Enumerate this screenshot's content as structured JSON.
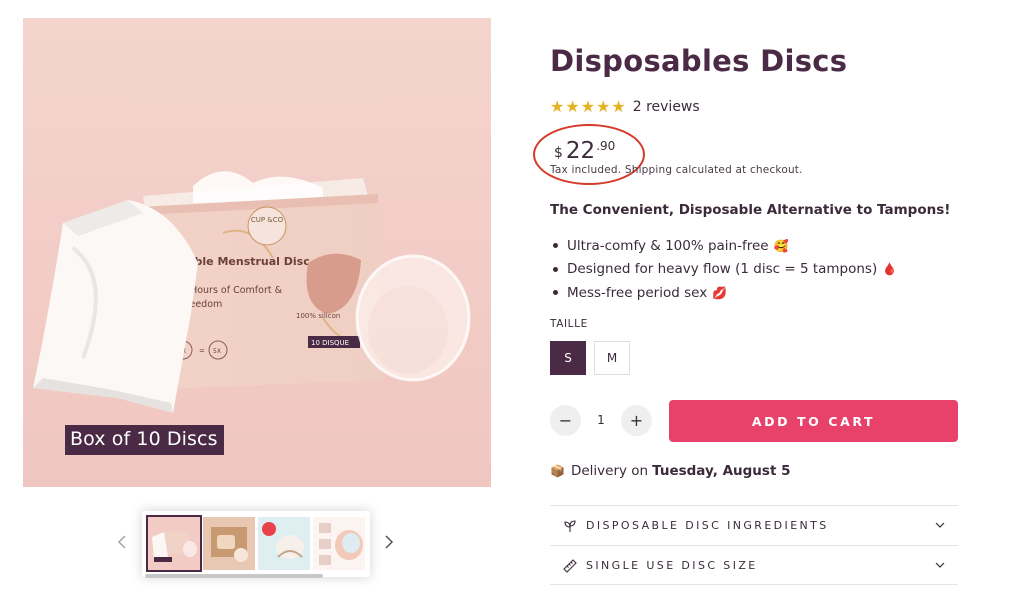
{
  "gallery": {
    "caption": "Box of 10 Discs",
    "product_box_text": {
      "brand": "CUP &CO",
      "name": "osable Menstrual Disc",
      "line1": "2 Hours of Comfort &",
      "line2": "Freedom",
      "silicone": "100% silicon",
      "qty": "10 DISQUE",
      "eq_left": "1X",
      "eq_right": "5X"
    },
    "thumbnail_count": 4,
    "selected_index": 0
  },
  "product": {
    "title": "Disposables Discs",
    "rating": 5,
    "stars": "★★★★★",
    "reviews": "2 reviews",
    "price": {
      "currency": "$",
      "whole": "22",
      "cents": ".90"
    },
    "tax_note": "Tax included. Shipping calculated at checkout.",
    "tagline": "The Convenient, Disposable Alternative to Tampons!",
    "bullets": [
      {
        "text": "Ultra-comfy & 100% pain-free",
        "emoji": "🥰"
      },
      {
        "text": "Designed for heavy flow (1 disc = 5 tampons)",
        "emoji": "🩸"
      },
      {
        "text": "Mess-free period sex",
        "emoji": "💋"
      }
    ]
  },
  "variants": {
    "label": "TAILLE",
    "options": [
      "S",
      "M"
    ],
    "selected": "S"
  },
  "cart": {
    "minus": "−",
    "plus": "+",
    "quantity": "1",
    "add_label": "ADD TO CART"
  },
  "delivery": {
    "icon": "📦",
    "prefix": "Delivery on",
    "date": "Tuesday, August 5"
  },
  "accordion": [
    {
      "label": "DISPOSABLE DISC INGREDIENTS",
      "icon": "leaf-icon"
    },
    {
      "label": "SINGLE USE DISC SIZE",
      "icon": "ruler-icon"
    }
  ],
  "colors": {
    "brand_plum": "#4a2a44",
    "cta_pink": "#e8426a",
    "star_gold": "#e5b223",
    "annotation_red": "#d63a2b",
    "image_bg": "#f3cfc9"
  }
}
